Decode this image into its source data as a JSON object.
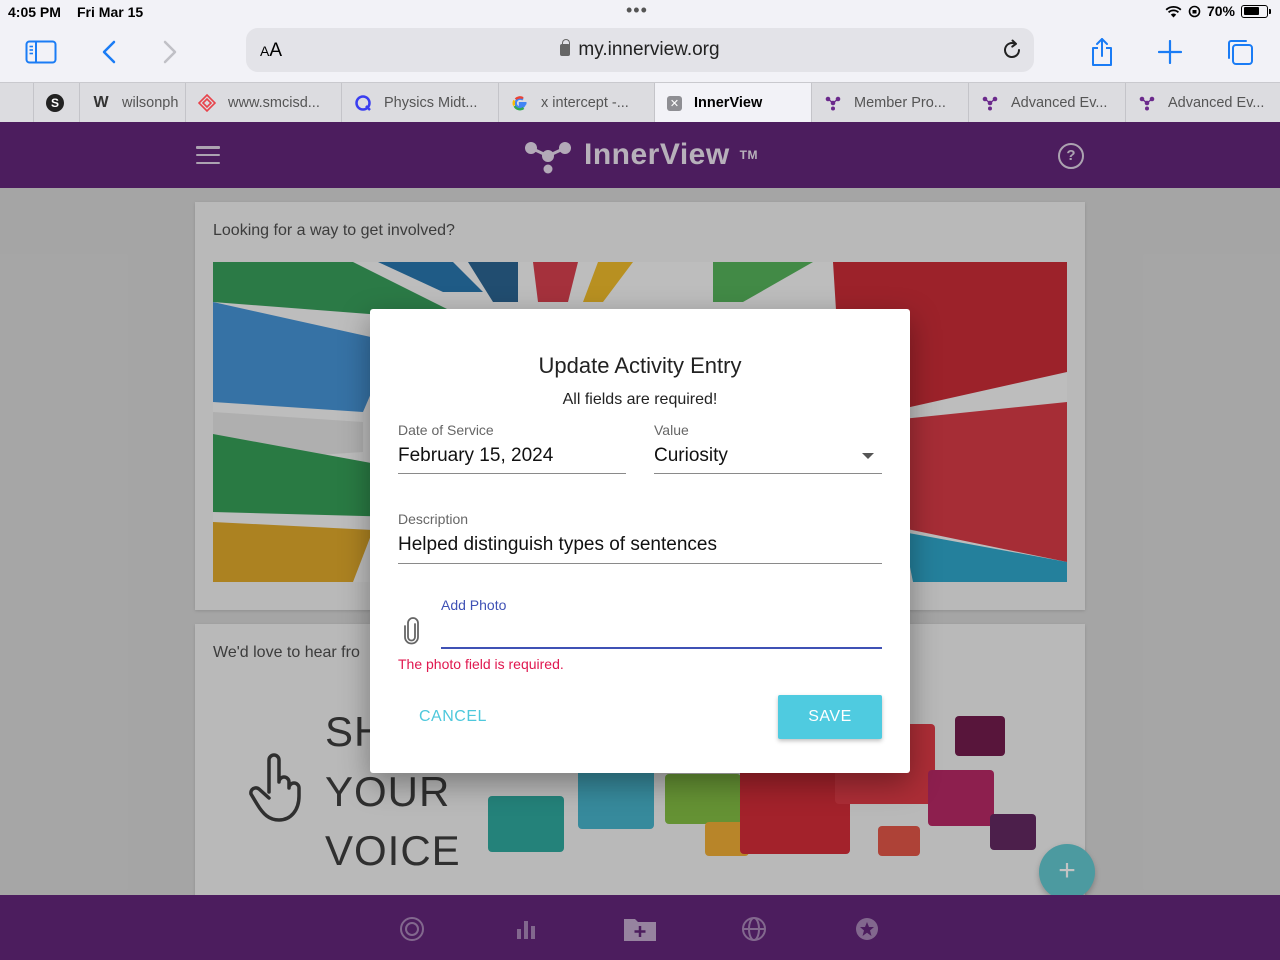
{
  "status_bar": {
    "time": "4:05 PM",
    "date": "Fri Mar 15",
    "battery": "70%"
  },
  "browser": {
    "text_size_label": "AA",
    "url": "my.innerview.org",
    "tabs": [
      {
        "label": "",
        "favicon": "s-circle-icon"
      },
      {
        "label": "wilsonph",
        "favicon": "weebly-w-icon"
      },
      {
        "label": "www.smcisd...",
        "favicon": "smcisd-icon"
      },
      {
        "label": "Physics Midt...",
        "favicon": "quizizz-q-icon"
      },
      {
        "label": "x intercept -...",
        "favicon": "google-g-icon"
      },
      {
        "label": "InnerView",
        "favicon": "close-tab-icon",
        "active": true
      },
      {
        "label": "Member Pro...",
        "favicon": "innerview-icon"
      },
      {
        "label": "Advanced Ev...",
        "favicon": "innerview-icon"
      },
      {
        "label": "Advanced Ev...",
        "favicon": "innerview-icon"
      }
    ]
  },
  "app": {
    "brand": "InnerView",
    "trademark": "TM",
    "card1_title": "Looking for a way to get involved?",
    "card2_title": "We'd love to hear fro",
    "voice_lines": [
      "SH",
      "YOUR",
      "VOICE"
    ],
    "fab_label": "+"
  },
  "modal": {
    "title": "Update Activity Entry",
    "subtitle": "All fields are required!",
    "date_label": "Date of Service",
    "date_value": "February 15, 2024",
    "value_label": "Value",
    "value_selected": "Curiosity",
    "description_label": "Description",
    "description_value": "Helped distinguish types of sentences",
    "photo_label": "Add Photo",
    "photo_error": "The photo field is required.",
    "cancel_label": "CANCEL",
    "save_label": "SAVE"
  },
  "colors": {
    "brand_purple": "#5b1a73",
    "accent_cyan": "#4fcbe0",
    "link_indigo": "#3f51b5",
    "error_red": "#e0174f",
    "ios_blue": "#1a7cf5"
  }
}
